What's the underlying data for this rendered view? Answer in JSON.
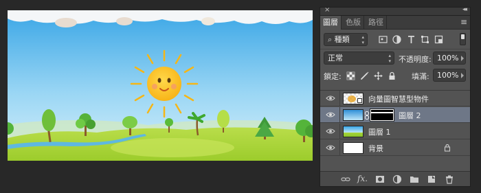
{
  "panel": {
    "close_glyph": "×",
    "collapse_glyph": "◂◂",
    "menu_glyph": "≡",
    "tabs": [
      {
        "label": "圖層",
        "active": true
      },
      {
        "label": "色版",
        "active": false
      },
      {
        "label": "路徑",
        "active": false
      }
    ]
  },
  "filter": {
    "kind_value": "種類",
    "search_glyph": "⌕"
  },
  "blend": {
    "mode_value": "正常",
    "opacity_label": "不透明度:",
    "opacity_value": "100%",
    "lock_label": "鎖定:",
    "fill_label": "填滿:",
    "fill_value": "100%"
  },
  "layers": [
    {
      "name": "向量圖智慧型物件",
      "type": "smart-object",
      "visible": true,
      "selected": false
    },
    {
      "name": "圖層 2",
      "type": "masked",
      "visible": true,
      "selected": true
    },
    {
      "name": "圖層 1",
      "type": "raster",
      "visible": true,
      "selected": false
    },
    {
      "name": "背景",
      "type": "background",
      "visible": true,
      "selected": false,
      "locked": true
    }
  ],
  "bottom_icons": [
    "link-icon",
    "fx-icon",
    "mask-icon",
    "adjustment-icon",
    "group-icon",
    "new-layer-icon",
    "trash-icon"
  ],
  "fx_label": "fx.",
  "colors": {
    "selected_row": "#6e7787",
    "panel_bg": "#535353",
    "workspace_bg": "#282828"
  }
}
